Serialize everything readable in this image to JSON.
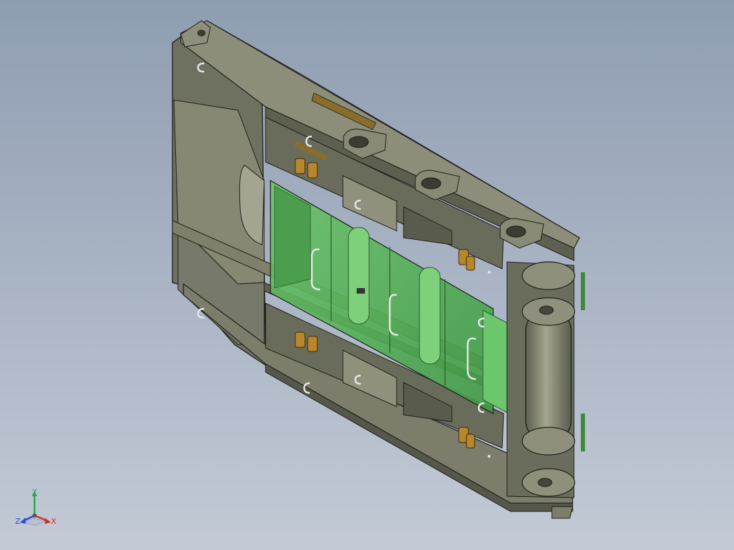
{
  "viewport": {
    "kind": "3d-cad-model-view"
  },
  "model": {
    "part": "mold-frame-assembly",
    "colors": {
      "steel": "#7b7d69",
      "steel_dark": "#55574a",
      "steel_light": "#9b9d89",
      "transparent_cavity": "#5fbf5f",
      "brass_clips": "#b8862b",
      "edges": "#1c1c18"
    }
  },
  "triad": {
    "axes": [
      {
        "label": "Y",
        "color": "#2da84a",
        "icon": "y-axis-arrow"
      },
      {
        "label": "X",
        "color": "#d32c2c",
        "icon": "x-axis-arrow"
      },
      {
        "label": "Z",
        "color": "#2a4bd4",
        "icon": "z-axis-arrow"
      }
    ]
  }
}
